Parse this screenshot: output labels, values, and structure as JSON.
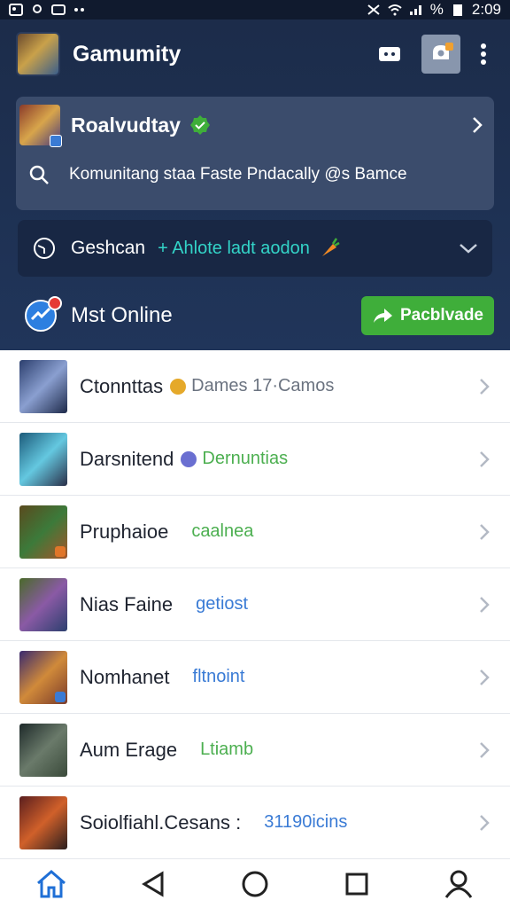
{
  "status_bar": {
    "time": "2:09",
    "battery": "%"
  },
  "app_bar": {
    "title": "Gamumity",
    "icons": [
      "message-icon",
      "camera-badge-icon",
      "more-vert-icon"
    ]
  },
  "featured": {
    "title": "Roalvudtay",
    "description": "Komunitang staa Faste Pndacally @s Bamce"
  },
  "filter": {
    "label": "Geshcan",
    "link": "+ Ahlote ladt aodon"
  },
  "online": {
    "title": "Mst Online",
    "button_label": "Pacblvade"
  },
  "list": [
    {
      "name": "Ctonnttas",
      "sub": "Dames 17·Camos",
      "status_color": "#e5a92a",
      "sub_color": "#6b7380",
      "thumb": [
        "#2c3f6e",
        "#8a9fd0",
        "#1e2a4a"
      ],
      "badge": ""
    },
    {
      "name": "Darsnitend",
      "sub": "Dernuntias",
      "status_color": "#6a6fd1",
      "sub_color": "#4caf50",
      "thumb": [
        "#1c5a7a",
        "#64c8e0",
        "#2a2f48"
      ],
      "badge": ""
    },
    {
      "name": "Pruphaioe",
      "sub": "caalnea",
      "status_color": "",
      "sub_color": "#4caf50",
      "thumb": [
        "#5a4a1e",
        "#3c7a3a",
        "#a5552a"
      ],
      "badge": "#e0762a"
    },
    {
      "name": "Nias Faine",
      "sub": "getiost",
      "status_color": "",
      "sub_color": "#3a7bd5",
      "thumb": [
        "#4a6a2a",
        "#8a5aa5",
        "#2c3f6e"
      ],
      "badge": ""
    },
    {
      "name": "Nomhanet",
      "sub": "fltnoint",
      "status_color": "",
      "sub_color": "#3a7bd5",
      "thumb": [
        "#3a2a6e",
        "#d08a3a",
        "#7a3a2a"
      ],
      "badge": "#3a7bd5"
    },
    {
      "name": "Aum Erage",
      "sub": "Ltiamb",
      "status_color": "",
      "sub_color": "#4caf50",
      "thumb": [
        "#1e2a2a",
        "#6a7a6a",
        "#3a4a3a"
      ],
      "badge": ""
    },
    {
      "name": "Soiolfiahl.Cesans :",
      "sub": "31190icins",
      "status_color": "",
      "sub_color": "#3a7bd5",
      "thumb": [
        "#5a1e1e",
        "#d0602a",
        "#2a1e1e"
      ],
      "badge": ""
    }
  ],
  "nav": {
    "items": [
      "home-icon",
      "back-icon",
      "home-circle-icon",
      "recents-icon",
      "profile-icon"
    ],
    "accent": "#1f6fd6"
  }
}
